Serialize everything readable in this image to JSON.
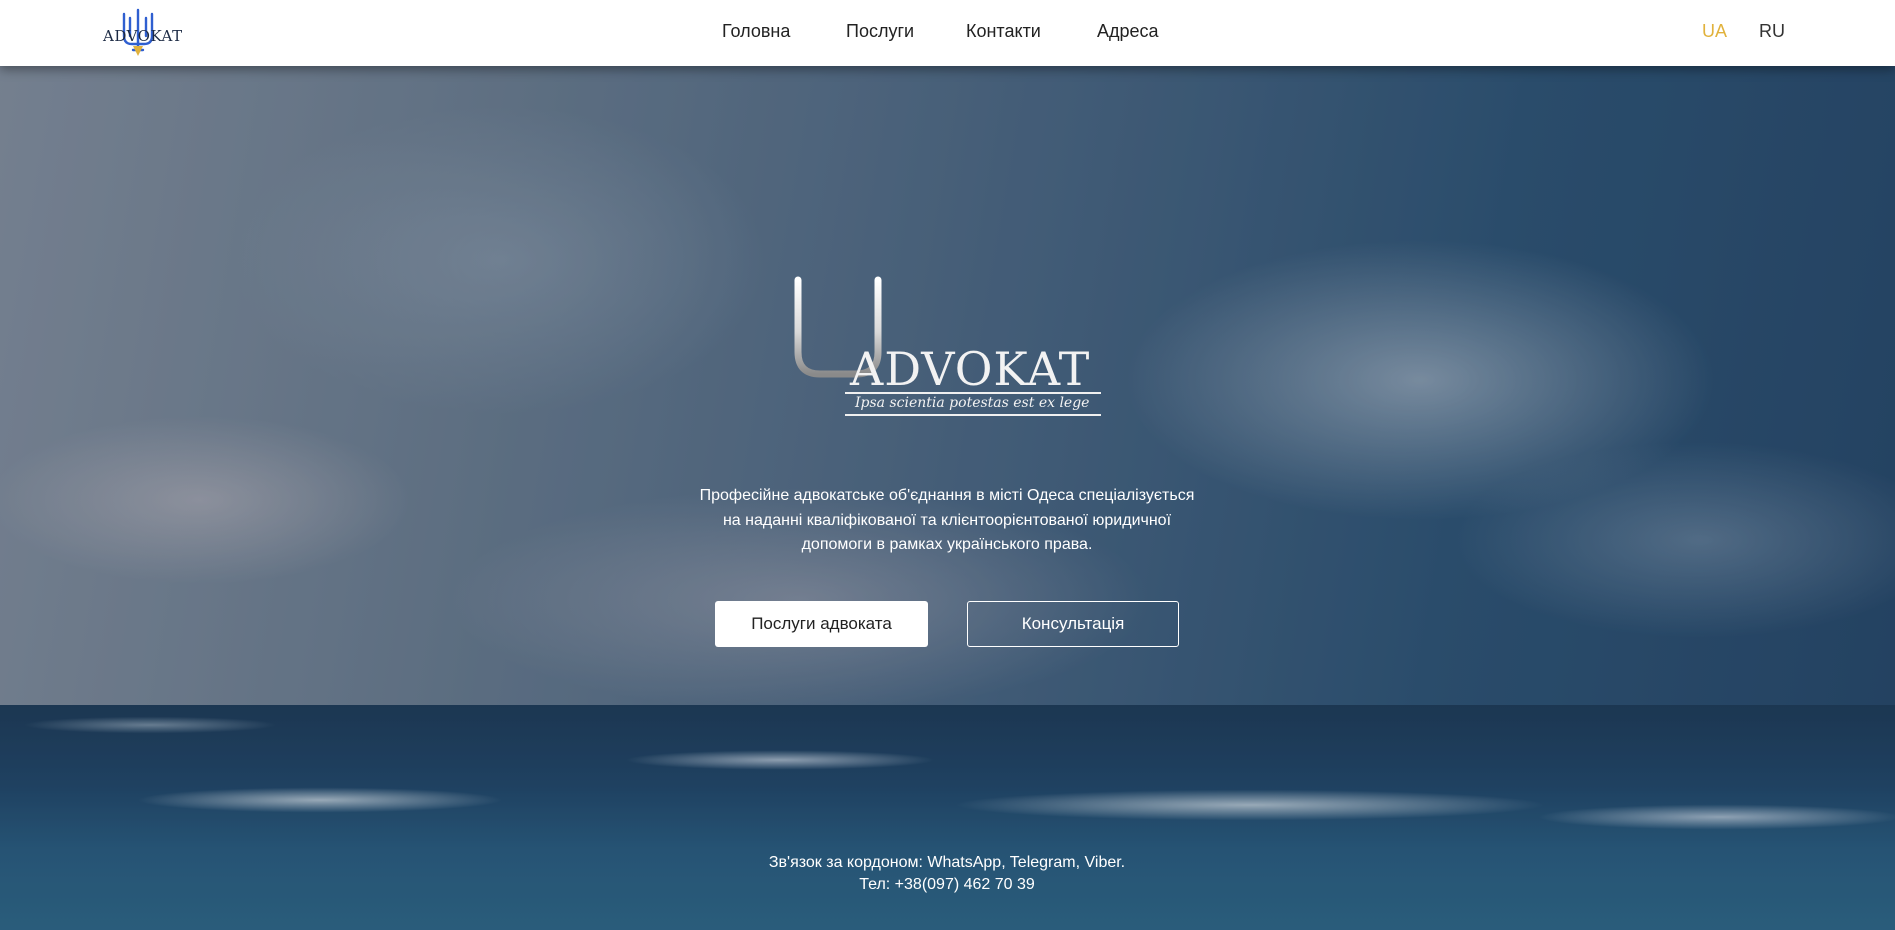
{
  "header": {
    "logo_text": "ADVOKAT",
    "nav": {
      "home": "Головна",
      "services": "Послуги",
      "contacts": "Контакти",
      "address": "Адреса"
    },
    "languages": {
      "ua": "UA",
      "ru": "RU"
    },
    "active_language_color": "#e1b23c"
  },
  "hero": {
    "logo_text": "ADVOKAT",
    "motto": "Ipsa scientia potestas est ex lege",
    "tagline_lines": [
      "Професійне адвокатське об'єднання в місті Одеса спеціалізується",
      "на наданні кваліфікованої та клієнтоорієнтованої юридичної",
      "допомоги в рамках українського права."
    ],
    "primary_button": "Послуги адвоката",
    "secondary_button": "Консультація"
  },
  "footer_contact": {
    "abroad": "Зв'язок за кордоном: WhatsApp, Telegram, Viber.",
    "phone": "Тел: +38(097) 462 70 39"
  },
  "icons": {
    "header_logo": "trident-icon",
    "hero_logo": "trident-icon"
  }
}
